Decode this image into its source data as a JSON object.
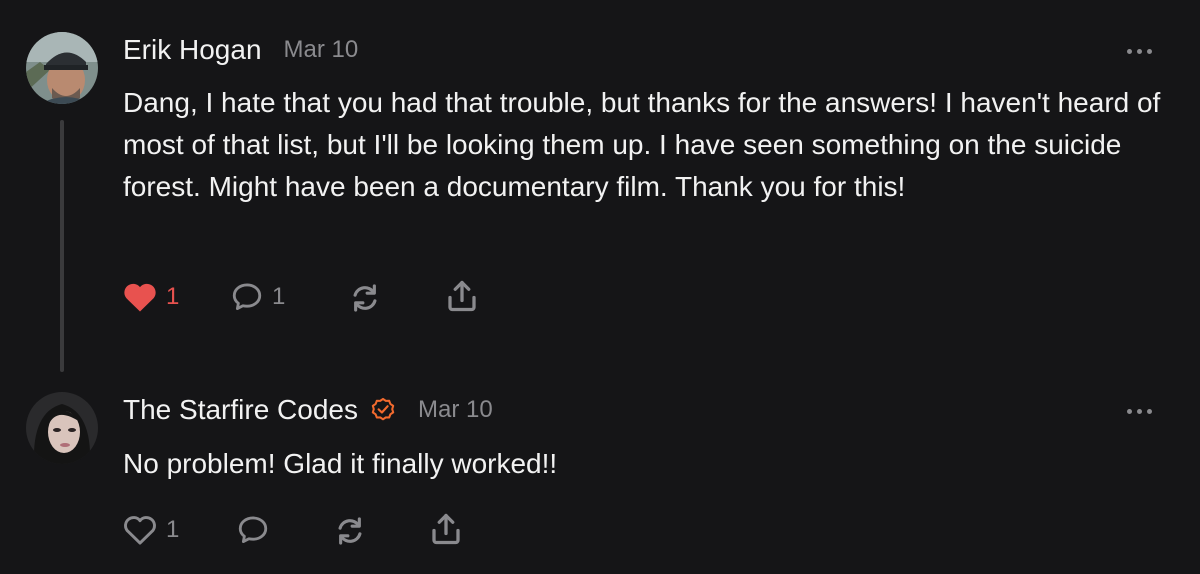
{
  "comments": [
    {
      "author": "Erik Hogan",
      "date": "Mar 10",
      "text": "Dang, I hate that you had that trouble, but thanks for the answers! I haven't heard of most of that list, but I'll be looking them up. I have seen something on the suicide forest. Might have been a documentary film. Thank you for this!",
      "likes": "1",
      "liked": true,
      "replies": "1"
    },
    {
      "author": "The Starfire Codes",
      "verified": true,
      "date": "Mar 10",
      "text": "No problem! Glad it finally worked!!",
      "likes": "1",
      "liked": false,
      "replies": ""
    }
  ],
  "colors": {
    "background": "#151517",
    "text": "#f2f2f2",
    "muted": "#8a8a8e",
    "like": "#e8524f",
    "verified": "#f26a2e"
  }
}
